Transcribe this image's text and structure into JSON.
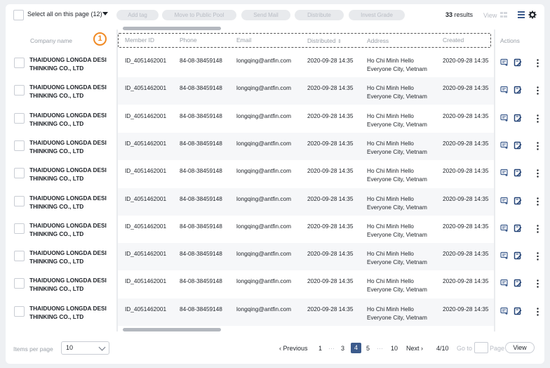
{
  "toolbar": {
    "select_all": "Select all on this page (12)",
    "buttons": [
      "Add tag",
      "Move to Public Pool",
      "Send Mail",
      "Distribute",
      "Invest Grade"
    ],
    "results_count": "33",
    "results_label": "results",
    "view_label": "View"
  },
  "annotation": {
    "marker": "1"
  },
  "columns": {
    "company": "Company name",
    "member_id": "Member ID",
    "phone": "Phone",
    "email": "Email",
    "distributed": "Distributed",
    "address": "Address",
    "created": "Created",
    "actions": "Actions"
  },
  "rows": [
    {
      "company": "THAIDUONG LONGDA DESI THINKING CO., LTD",
      "member_id": "ID_4051462001",
      "phone": "84-08-38459148",
      "email": "longqing@antfin.com",
      "distributed": "2020-09-28 14:35",
      "address": "Ho Chi Minh Hello Everyone City, Vietnam",
      "created": "2020-09-28 14:35"
    },
    {
      "company": "THAIDUONG LONGDA DESI THINKING CO., LTD",
      "member_id": "ID_4051462001",
      "phone": "84-08-38459148",
      "email": "longqing@antfin.com",
      "distributed": "2020-09-28 14:35",
      "address": "Ho Chi Minh Hello Everyone City, Vietnam",
      "created": "2020-09-28 14:35"
    },
    {
      "company": "THAIDUONG LONGDA DESI THINKING CO., LTD",
      "member_id": "ID_4051462001",
      "phone": "84-08-38459148",
      "email": "longqing@antfin.com",
      "distributed": "2020-09-28 14:35",
      "address": "Ho Chi Minh Hello Everyone City, Vietnam",
      "created": "2020-09-28 14:35"
    },
    {
      "company": "THAIDUONG LONGDA DESI THINKING CO., LTD",
      "member_id": "ID_4051462001",
      "phone": "84-08-38459148",
      "email": "longqing@antfin.com",
      "distributed": "2020-09-28 14:35",
      "address": "Ho Chi Minh Hello Everyone City, Vietnam",
      "created": "2020-09-28 14:35"
    },
    {
      "company": "THAIDUONG LONGDA DESI THINKING CO., LTD",
      "member_id": "ID_4051462001",
      "phone": "84-08-38459148",
      "email": "longqing@antfin.com",
      "distributed": "2020-09-28 14:35",
      "address": "Ho Chi Minh Hello Everyone City, Vietnam",
      "created": "2020-09-28 14:35"
    },
    {
      "company": "THAIDUONG LONGDA DESI THINKING CO., LTD",
      "member_id": "ID_4051462001",
      "phone": "84-08-38459148",
      "email": "longqing@antfin.com",
      "distributed": "2020-09-28 14:35",
      "address": "Ho Chi Minh Hello Everyone City, Vietnam",
      "created": "2020-09-28 14:35"
    },
    {
      "company": "THAIDUONG LONGDA DESI THINKING CO., LTD",
      "member_id": "ID_4051462001",
      "phone": "84-08-38459148",
      "email": "longqing@antfin.com",
      "distributed": "2020-09-28 14:35",
      "address": "Ho Chi Minh Hello Everyone City, Vietnam",
      "created": "2020-09-28 14:35"
    },
    {
      "company": "THAIDUONG LONGDA DESI THINKING CO., LTD",
      "member_id": "ID_4051462001",
      "phone": "84-08-38459148",
      "email": "longqing@antfin.com",
      "distributed": "2020-09-28 14:35",
      "address": "Ho Chi Minh Hello Everyone City, Vietnam",
      "created": "2020-09-28 14:35"
    },
    {
      "company": "THAIDUONG LONGDA DESI THINKING CO., LTD",
      "member_id": "ID_4051462001",
      "phone": "84-08-38459148",
      "email": "longqing@antfin.com",
      "distributed": "2020-09-28 14:35",
      "address": "Ho Chi Minh Hello Everyone City, Vietnam",
      "created": "2020-09-28 14:35"
    },
    {
      "company": "THAIDUONG LONGDA DESI THINKING CO., LTD",
      "member_id": "ID_4051462001",
      "phone": "84-08-38459148",
      "email": "longqing@antfin.com",
      "distributed": "2020-09-28 14:35",
      "address": "Ho Chi Minh Hello Everyone City, Vietnam",
      "created": "2020-09-28 14:35"
    }
  ],
  "footer": {
    "items_per_page_label": "Items per page",
    "items_per_page_value": "10",
    "previous": "‹ Previous",
    "pages": [
      "1",
      "···",
      "3",
      "4",
      "5",
      "···",
      "10"
    ],
    "current_page": "4",
    "next": "Next ›",
    "page_of": "4/10",
    "goto_label": "Go to",
    "page_label": "Page",
    "view_button": "View"
  },
  "colors": {
    "accent": "#3c5b8c",
    "annotation": "#f08a24"
  }
}
